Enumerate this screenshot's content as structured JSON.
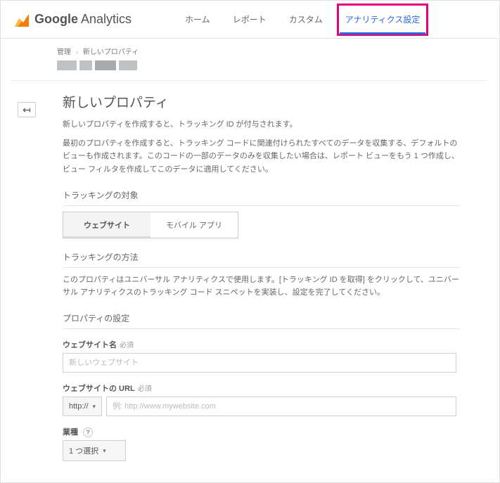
{
  "brand": {
    "name1": "Google",
    "name2": " Analytics"
  },
  "nav": {
    "home": "ホーム",
    "report": "レポート",
    "custom": "カスタム",
    "admin": "アナリティクス設定"
  },
  "breadcrumb": {
    "root": "管理",
    "current": "新しいプロパティ"
  },
  "page": {
    "title": "新しいプロパティ",
    "intro1": "新しいプロパティを作成すると、トラッキング ID が付与されます。",
    "intro2": "最初のプロパティを作成すると、トラッキング コードに関連付けられたすべてのデータを収集する、デフォルトのビューも作成されます。このコードの一部のデータのみを収集したい場合は、レポート ビューをもう 1 つ作成し、ビュー フィルタを作成してこのデータに適用してください。"
  },
  "tracking_target": {
    "heading": "トラッキングの対象",
    "website": "ウェブサイト",
    "mobile": "モバイル アプリ"
  },
  "tracking_method": {
    "heading": "トラッキングの方法",
    "body": "このプロパティはユニバーサル アナリティクスで使用します。[トラッキング ID を取得] をクリックして、ユニバーサル アナリティクスのトラッキング コード スニペットを実装し、設定を完了してください。"
  },
  "property_settings": {
    "heading": "プロパティの設定",
    "site_name_label": "ウェブサイト名",
    "required": "必須",
    "site_name_placeholder": "新しいウェブサイト",
    "site_url_label": "ウェブサイトの URL",
    "protocol": "http://",
    "url_placeholder": "例: http://www.mywebsite.com",
    "industry_label": "業種",
    "industry_value": "1 つ選択"
  }
}
